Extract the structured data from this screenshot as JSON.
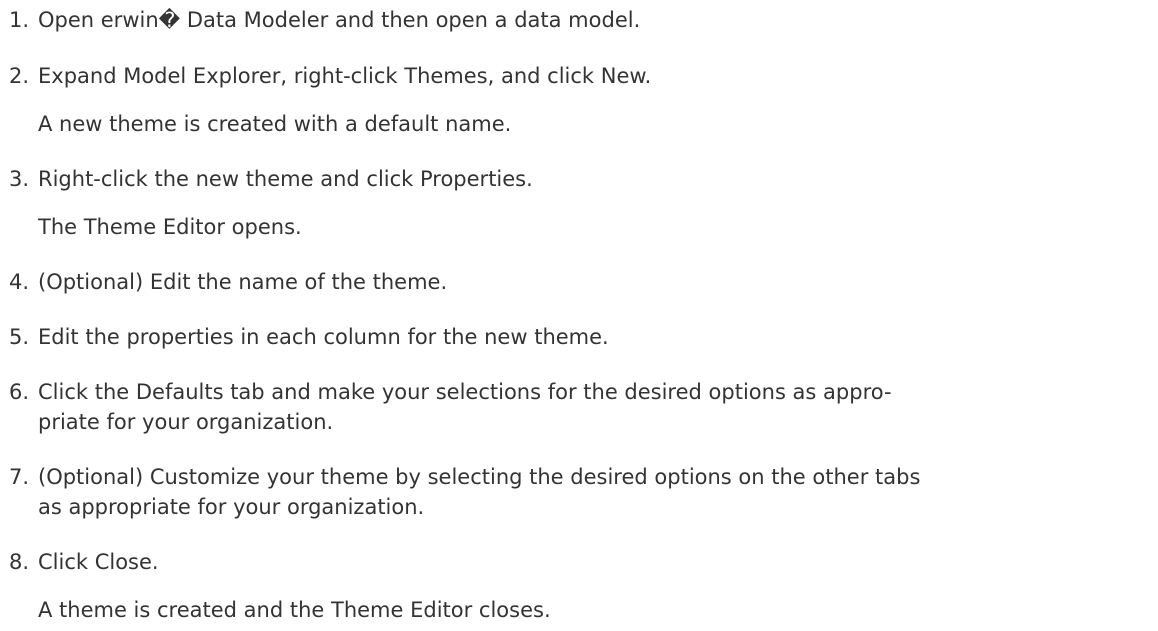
{
  "steps": [
    {
      "num": "1.",
      "lines": [
        "Open erwin� Data Modeler and then open a data model."
      ]
    },
    {
      "num": "2.",
      "lines": [
        "Expand Model Explorer, right-click Themes, and click New."
      ],
      "note": "A new theme is created with a default name."
    },
    {
      "num": "3.",
      "lines": [
        "Right-click the new theme and click Properties."
      ],
      "note": "The Theme Editor opens."
    },
    {
      "num": "4.",
      "lines": [
        "(Optional) Edit the name of the theme."
      ]
    },
    {
      "num": "5.",
      "lines": [
        "Edit the properties in each column for the new theme."
      ]
    },
    {
      "num": "6.",
      "lines": [
        "Click the Defaults tab and make your selections for the desired options as appro-",
        "priate for your organization."
      ]
    },
    {
      "num": "7.",
      "lines": [
        "(Optional) Customize your theme by selecting the desired options on the other tabs",
        "as appropriate for your organization."
      ]
    },
    {
      "num": "8.",
      "lines": [
        "Click Close."
      ],
      "note": "A theme is created and the Theme Editor closes."
    }
  ]
}
